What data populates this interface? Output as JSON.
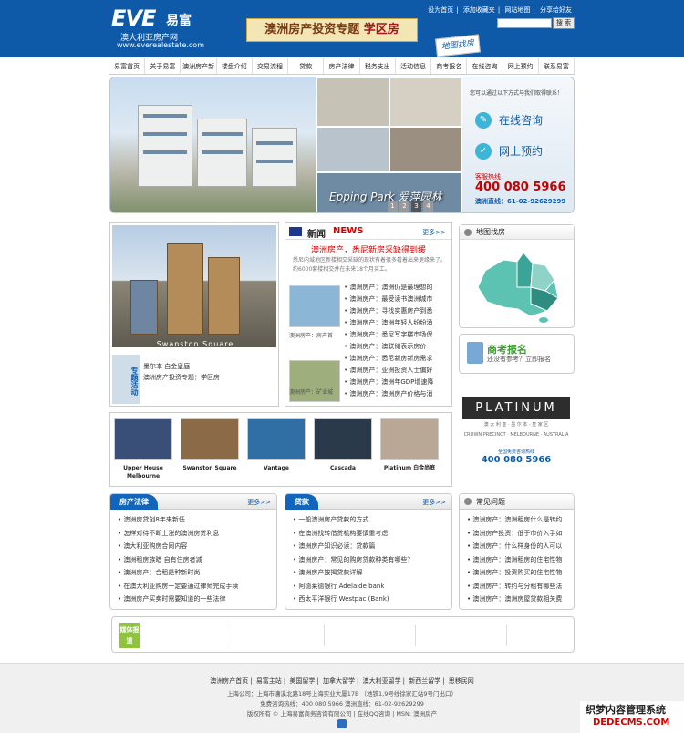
{
  "header": {
    "logo_brand": "EVE",
    "logo_cn": "易富",
    "logo_sub1": "澳大利亚房产网",
    "logo_sub2": "www.everealestate.com",
    "banner_text": "澳洲房产投资专题",
    "banner_highlight": "学区房",
    "stamp_text": "地图找房",
    "toplinks": [
      "设为首页",
      "添加收藏夹",
      "网站地图",
      "分享给好友"
    ],
    "search_button": "搜 索"
  },
  "nav": [
    "易富首页",
    "关于易富",
    "澳洲房产新闻",
    "楼盘介绍",
    "交易流程",
    "贷款",
    "房产法律",
    "税务支出",
    "活动信息",
    "商考报名",
    "在线咨询",
    "网上预约",
    "联系易富"
  ],
  "hero": {
    "caption": "Epping Park 爱萍园林",
    "dots": [
      "1",
      "2",
      "3",
      "4"
    ],
    "active_dot": "3",
    "contact_intro": "您可以通过以下方式与我们取得联系！",
    "online_consult": "在线咨询",
    "online_booking": "网上预约",
    "hotline_label": "客服热线",
    "hotline": "400 080 5966",
    "direct_line": "澳洲直线：61-02-92629299"
  },
  "feature": {
    "image_caption": "Swanston Square",
    "side_label": "专题活动",
    "text1": "墨尔本 白金皇庭",
    "text2": "澳洲房产投资专题：学区房"
  },
  "news": {
    "title_cn": "新闻",
    "title_en": "NEWS",
    "more": "更多>>",
    "headline": "澳洲房产，悉尼新房采缺得到缓",
    "summary": "悉尼内城地区新楼相交采缺的现状有着很多看着出来更缘来了。约6000套楼相交并在未来18个月买工。",
    "photo1_caption": "澳洲房产：房产首",
    "photo2_caption": "澳洲房产：矿业城",
    "items": [
      "澳洲房产：澳洲仍是最理想的",
      "澳洲房产：最受读书澳洲城市",
      "澳洲房产：寻找实惠房产到悉",
      "澳洲房产：澳洲年轻人纷纷涌",
      "澳洲房产：悉尼写字楼市场保",
      "澳洲房产：澳联储表示房价",
      "澳洲房产：悉尼新房新房需求",
      "澳洲房产：亚洲投资人士偏好",
      "澳洲房产：澳洲年GDP增速降",
      "澳洲房产：澳洲房产价格与消"
    ]
  },
  "right": {
    "map_title": "地图找房",
    "map_label": "Australia",
    "reg_title": "商考报名",
    "reg_sub": "还没有参考？立即报名",
    "plat_title": "PLATINUM",
    "plat_sub": "澳 大 利 亚 · 墨 尔 本 · 皇 家 区",
    "plat_loc": "CROWN PRECINCT · MELBOURNE · AUSTRALIA",
    "plat_phone_label": "全国免费咨询热线",
    "plat_phone": "400 080 5966"
  },
  "projects": [
    {
      "label": "Upper House Melbourne",
      "color": "#3a4f78"
    },
    {
      "label": "Swanston Square",
      "color": "#8a6a47"
    },
    {
      "label": "Vantage",
      "color": "#2f6fa3"
    },
    {
      "label": "Cascada",
      "color": "#2a3a4a"
    },
    {
      "label": "Platinum 白金尚庭",
      "color": "#b9a895"
    }
  ],
  "law": {
    "title": "房产法律",
    "more": "更多>>",
    "items": [
      "澳洲房贷创8年来新低",
      "怎样对待不断上涨的澳洲房贷利息",
      "澳大利亚购房合同内容",
      "澳洲租房族暗 自有住房者减",
      "澳洲房产：合租是种新时尚",
      "在澳大利亚购房一定要通过律师完成手续",
      "澳洲房产买卖时需要知道的一些法律"
    ]
  },
  "loan": {
    "title": "贷款",
    "more": "更多>>",
    "items": [
      "一般澳洲房产贷款的方式",
      "在澳洲找转借贷机构要慎重考虑",
      "澳洲房产知识必读：贷款篇",
      "澳洲房产：常见的购房贷款种类有哪些？",
      "澳洲房产按揭贷款详解",
      "阿德莱德银行 Adelaide bank",
      "西太平洋银行 Westpac (Bank)"
    ]
  },
  "faq": {
    "title": "常见问题",
    "items": [
      "澳洲房产：澳洲租房什么是转约",
      "澳洲房产投资：低于市价入手如",
      "澳洲房产：什么样身份的人可以",
      "澳洲房产：澳洲租房的住宅性物",
      "澳洲房产：投资购买的住宅性物",
      "澳洲房产：转约与分租有哪些法",
      "澳洲房产：澳洲房屋贷款相关费"
    ]
  },
  "media": {
    "label": "媒体报道"
  },
  "footer": {
    "links": [
      "澳洲房产首页",
      "易富主站",
      "美国留学",
      "加拿大留学",
      "澳大利亚留学",
      "新西兰留学",
      "思移民网"
    ],
    "address": "上海公司：上海市漕溪北路18号上海实业大厦17B （地铁1,9号线徐家汇站9号门出口）",
    "phone": "免费咨询热线：400 080 5966  澳洲直线：61-02-92629299",
    "copyright": "版权所有 © 上海易富商务咨询有限公司  |  在线QQ咨询  |  MSN: 澳洲房产"
  },
  "watermark": {
    "line1": "织梦内容管理系统",
    "line2": "DEDECMS.COM"
  }
}
